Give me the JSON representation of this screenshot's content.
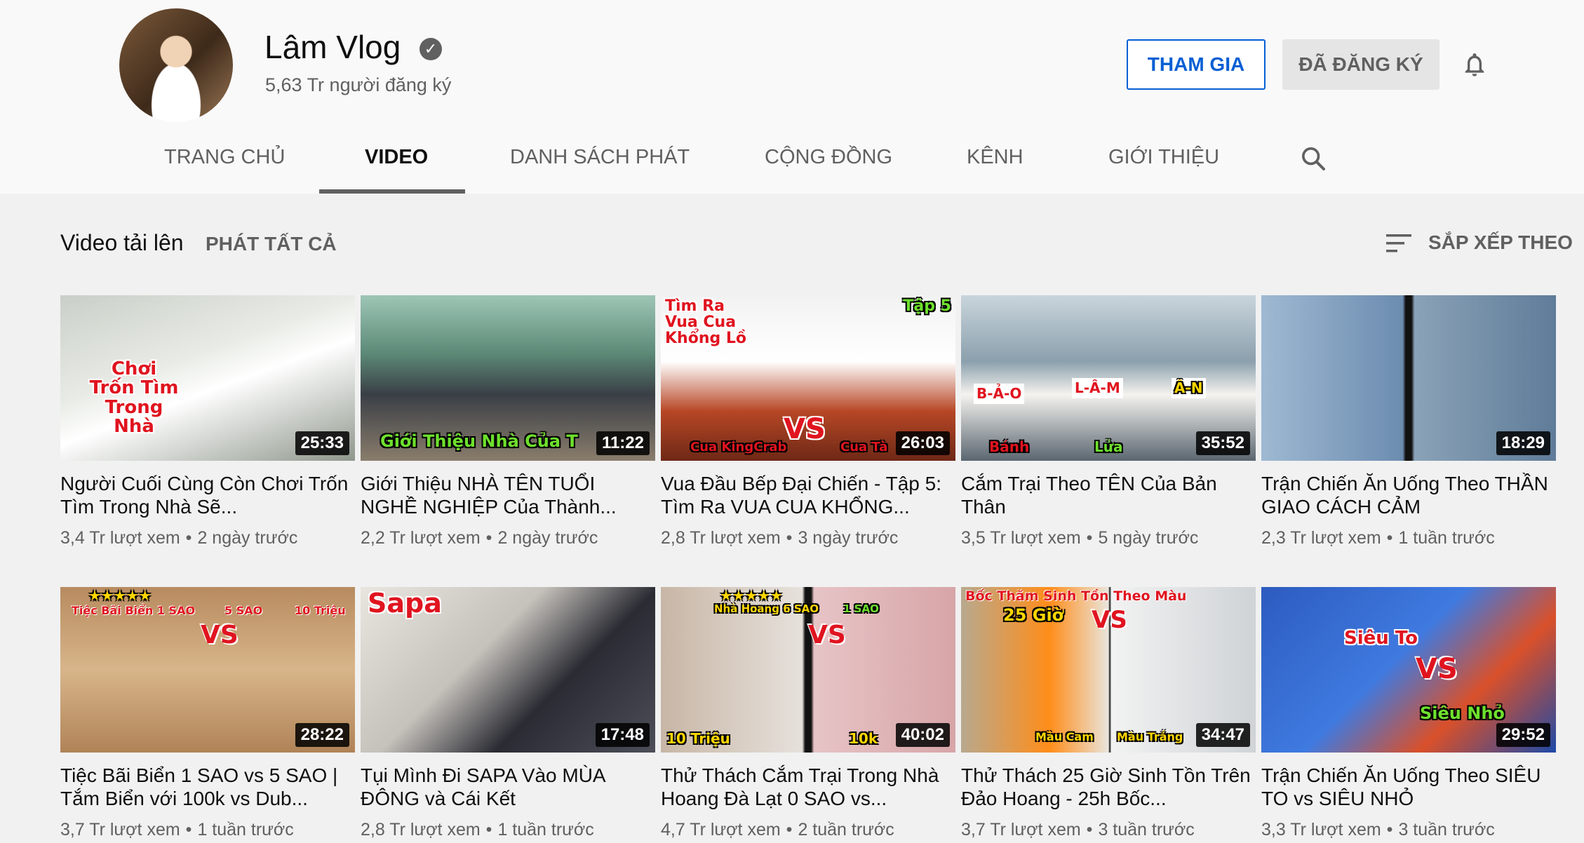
{
  "channel": {
    "name": "Lâm Vlog",
    "verified_glyph": "✓",
    "subscribers": "5,63 Tr người đăng ký"
  },
  "actions": {
    "join_label": "THAM GIA",
    "subscribed_label": "ĐÃ ĐĂNG KÝ"
  },
  "tabs": [
    {
      "label": "TRANG CHỦ",
      "active": false
    },
    {
      "label": "VIDEO",
      "active": true
    },
    {
      "label": "DANH SÁCH PHÁT",
      "active": false
    },
    {
      "label": "CỘNG ĐỒNG",
      "active": false
    },
    {
      "label": "KÊNH",
      "active": false
    },
    {
      "label": "GIỚI THIỆU",
      "active": false
    }
  ],
  "section": {
    "title": "Video tải lên",
    "play_all": "PHÁT TẤT CẢ",
    "sort_label": "SẮP XẾP THEO"
  },
  "videos": [
    {
      "title": "Người Cuối Cùng Còn Chơi Trốn Tìm Trong Nhà Sẽ...",
      "views": "3,4 Tr lượt xem",
      "age": "2 ngày trước",
      "duration": "25:33",
      "thumb_text": [
        "Chơi",
        "Trốn Tìm",
        "Trong",
        "Nhà"
      ]
    },
    {
      "title": "Giới Thiệu NHÀ TÊN TUỔI NGHỀ NGHIỆP Của Thành...",
      "views": "2,2 Tr lượt xem",
      "age": "2 ngày trước",
      "duration": "11:22",
      "thumb_text": [
        "Giới Thiệu Nhà Của T"
      ]
    },
    {
      "title": "Vua Đầu Bếp Đại Chiến - Tập 5: Tìm Ra VUA CUA KHỔNG...",
      "views": "2,8 Tr lượt xem",
      "age": "3 ngày trước",
      "duration": "26:03",
      "thumb_text": [
        "Tìm Ra",
        "Vua Cua",
        "Khổng Lồ",
        "Tập 5",
        "VS",
        "Cua KingCrab",
        "Cua Tà"
      ]
    },
    {
      "title": "Cắm Trại Theo TÊN Của Bản Thân",
      "views": "3,5 Tr lượt xem",
      "age": "5 ngày trước",
      "duration": "35:52",
      "thumb_text": [
        "B-Ả-O",
        "L-Â-M",
        "Â-N",
        "Bánh",
        "Lửa"
      ]
    },
    {
      "title": "Trận Chiến Ăn Uống Theo THẦN GIAO CÁCH CẢM",
      "views": "2,3 Tr lượt xem",
      "age": "1 tuần trước",
      "duration": "18:29",
      "thumb_text": []
    },
    {
      "title": "Tiệc Bãi Biển 1 SAO vs 5 SAO | Tắm Biển với 100k vs Dub...",
      "views": "3,7 Tr lượt xem",
      "age": "1 tuần trước",
      "duration": "28:22",
      "thumb_text": [
        "★★★★★",
        "Tiệc Bãi Biển 1 SAO",
        "5 SAO",
        "10 Triệu",
        "VS"
      ]
    },
    {
      "title": "Tụi Mình Đi SAPA Vào MÙA ĐÔNG và Cái Kết",
      "views": "2,8 Tr lượt xem",
      "age": "1 tuần trước",
      "duration": "17:48",
      "thumb_text": [
        "Sapa"
      ]
    },
    {
      "title": "Thử Thách Cắm Trại Trong Nhà Hoang Đà Lạt 0 SAO vs...",
      "views": "4,7 Tr lượt xem",
      "age": "2 tuần trước",
      "duration": "40:02",
      "thumb_text": [
        "★★★★★",
        "Nhà Hoang 6 SAO",
        "1 SAO",
        "VS",
        "10 Triệu",
        "10k"
      ]
    },
    {
      "title": "Thử Thách 25 Giờ Sinh Tồn Trên Đảo Hoang - 25h Bốc...",
      "views": "3,7 Tr lượt xem",
      "age": "3 tuần trước",
      "duration": "34:47",
      "thumb_text": [
        "Bốc Thăm Sinh Tồn Theo Màu",
        "25 Giờ",
        "VS",
        "Màu Cam",
        "Màu Trắng"
      ]
    },
    {
      "title": "Trận Chiến Ăn Uống Theo SIÊU TO vs SIÊU NHỎ",
      "views": "3,3 Tr lượt xem",
      "age": "3 tuần trước",
      "duration": "29:52",
      "thumb_text": [
        "Siêu To",
        "VS",
        "Siêu Nhỏ"
      ]
    }
  ],
  "colors": {
    "accent_blue": "#065fd4",
    "text_secondary": "#606060",
    "thumb_red": "#e0141f",
    "thumb_yellow": "#ffd600",
    "thumb_green": "#6ee02d"
  }
}
